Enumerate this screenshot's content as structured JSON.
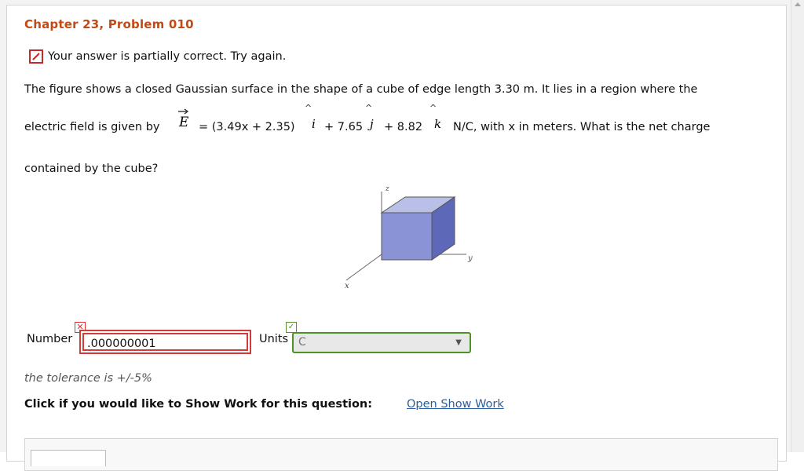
{
  "problem": {
    "title": "Chapter 23, Problem 010",
    "status_text": "Your answer is partially correct.  Try again.",
    "line1": "The figure shows a closed Gaussian surface in the shape of a cube of edge length 3.30 m. It lies in a region where the",
    "line2_prefix": "electric field is given by",
    "E_symbol": "E",
    "expr_part1": "= (3.49x + 2.35)",
    "i_symbol": "i",
    "expr_part2": "+ 7.65",
    "j_symbol": "j",
    "expr_part3": "+ 8.82",
    "k_symbol": "k",
    "expr_part4": "N/C, with x in meters. What is the net charge",
    "line3": "contained by the cube?"
  },
  "figure": {
    "axis_z": "z",
    "axis_y": "y",
    "axis_x": "x",
    "cube_front": "#8a93d6",
    "cube_top": "#b9bfe6",
    "cube_side": "#5d68b8"
  },
  "answer": {
    "number_label": "Number",
    "number_value": ".000000001",
    "number_state": "incorrect",
    "units_label": "Units",
    "units_value": "C",
    "units_state": "correct"
  },
  "footer": {
    "tolerance": "the tolerance is +/-5%",
    "show_work_prompt": "Click if you would like to Show Work for this question:",
    "show_work_link": "Open Show Work"
  },
  "colors": {
    "title": "#c24a15",
    "incorrect": "#d43a3a",
    "correct": "#4f9125",
    "link": "#2a5f9e"
  }
}
